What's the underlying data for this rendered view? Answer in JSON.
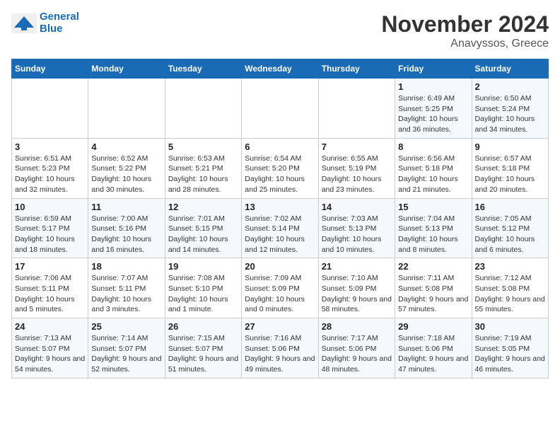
{
  "logo": {
    "line1": "General",
    "line2": "Blue"
  },
  "header": {
    "month": "November 2024",
    "location": "Anavyssos, Greece"
  },
  "days_of_week": [
    "Sunday",
    "Monday",
    "Tuesday",
    "Wednesday",
    "Thursday",
    "Friday",
    "Saturday"
  ],
  "weeks": [
    [
      {
        "day": "",
        "info": ""
      },
      {
        "day": "",
        "info": ""
      },
      {
        "day": "",
        "info": ""
      },
      {
        "day": "",
        "info": ""
      },
      {
        "day": "",
        "info": ""
      },
      {
        "day": "1",
        "info": "Sunrise: 6:49 AM\nSunset: 5:25 PM\nDaylight: 10 hours and 36 minutes."
      },
      {
        "day": "2",
        "info": "Sunrise: 6:50 AM\nSunset: 5:24 PM\nDaylight: 10 hours and 34 minutes."
      }
    ],
    [
      {
        "day": "3",
        "info": "Sunrise: 6:51 AM\nSunset: 5:23 PM\nDaylight: 10 hours and 32 minutes."
      },
      {
        "day": "4",
        "info": "Sunrise: 6:52 AM\nSunset: 5:22 PM\nDaylight: 10 hours and 30 minutes."
      },
      {
        "day": "5",
        "info": "Sunrise: 6:53 AM\nSunset: 5:21 PM\nDaylight: 10 hours and 28 minutes."
      },
      {
        "day": "6",
        "info": "Sunrise: 6:54 AM\nSunset: 5:20 PM\nDaylight: 10 hours and 25 minutes."
      },
      {
        "day": "7",
        "info": "Sunrise: 6:55 AM\nSunset: 5:19 PM\nDaylight: 10 hours and 23 minutes."
      },
      {
        "day": "8",
        "info": "Sunrise: 6:56 AM\nSunset: 5:18 PM\nDaylight: 10 hours and 21 minutes."
      },
      {
        "day": "9",
        "info": "Sunrise: 6:57 AM\nSunset: 5:18 PM\nDaylight: 10 hours and 20 minutes."
      }
    ],
    [
      {
        "day": "10",
        "info": "Sunrise: 6:59 AM\nSunset: 5:17 PM\nDaylight: 10 hours and 18 minutes."
      },
      {
        "day": "11",
        "info": "Sunrise: 7:00 AM\nSunset: 5:16 PM\nDaylight: 10 hours and 16 minutes."
      },
      {
        "day": "12",
        "info": "Sunrise: 7:01 AM\nSunset: 5:15 PM\nDaylight: 10 hours and 14 minutes."
      },
      {
        "day": "13",
        "info": "Sunrise: 7:02 AM\nSunset: 5:14 PM\nDaylight: 10 hours and 12 minutes."
      },
      {
        "day": "14",
        "info": "Sunrise: 7:03 AM\nSunset: 5:13 PM\nDaylight: 10 hours and 10 minutes."
      },
      {
        "day": "15",
        "info": "Sunrise: 7:04 AM\nSunset: 5:13 PM\nDaylight: 10 hours and 8 minutes."
      },
      {
        "day": "16",
        "info": "Sunrise: 7:05 AM\nSunset: 5:12 PM\nDaylight: 10 hours and 6 minutes."
      }
    ],
    [
      {
        "day": "17",
        "info": "Sunrise: 7:06 AM\nSunset: 5:11 PM\nDaylight: 10 hours and 5 minutes."
      },
      {
        "day": "18",
        "info": "Sunrise: 7:07 AM\nSunset: 5:11 PM\nDaylight: 10 hours and 3 minutes."
      },
      {
        "day": "19",
        "info": "Sunrise: 7:08 AM\nSunset: 5:10 PM\nDaylight: 10 hours and 1 minute."
      },
      {
        "day": "20",
        "info": "Sunrise: 7:09 AM\nSunset: 5:09 PM\nDaylight: 10 hours and 0 minutes."
      },
      {
        "day": "21",
        "info": "Sunrise: 7:10 AM\nSunset: 5:09 PM\nDaylight: 9 hours and 58 minutes."
      },
      {
        "day": "22",
        "info": "Sunrise: 7:11 AM\nSunset: 5:08 PM\nDaylight: 9 hours and 57 minutes."
      },
      {
        "day": "23",
        "info": "Sunrise: 7:12 AM\nSunset: 5:08 PM\nDaylight: 9 hours and 55 minutes."
      }
    ],
    [
      {
        "day": "24",
        "info": "Sunrise: 7:13 AM\nSunset: 5:07 PM\nDaylight: 9 hours and 54 minutes."
      },
      {
        "day": "25",
        "info": "Sunrise: 7:14 AM\nSunset: 5:07 PM\nDaylight: 9 hours and 52 minutes."
      },
      {
        "day": "26",
        "info": "Sunrise: 7:15 AM\nSunset: 5:07 PM\nDaylight: 9 hours and 51 minutes."
      },
      {
        "day": "27",
        "info": "Sunrise: 7:16 AM\nSunset: 5:06 PM\nDaylight: 9 hours and 49 minutes."
      },
      {
        "day": "28",
        "info": "Sunrise: 7:17 AM\nSunset: 5:06 PM\nDaylight: 9 hours and 48 minutes."
      },
      {
        "day": "29",
        "info": "Sunrise: 7:18 AM\nSunset: 5:06 PM\nDaylight: 9 hours and 47 minutes."
      },
      {
        "day": "30",
        "info": "Sunrise: 7:19 AM\nSunset: 5:05 PM\nDaylight: 9 hours and 46 minutes."
      }
    ]
  ]
}
